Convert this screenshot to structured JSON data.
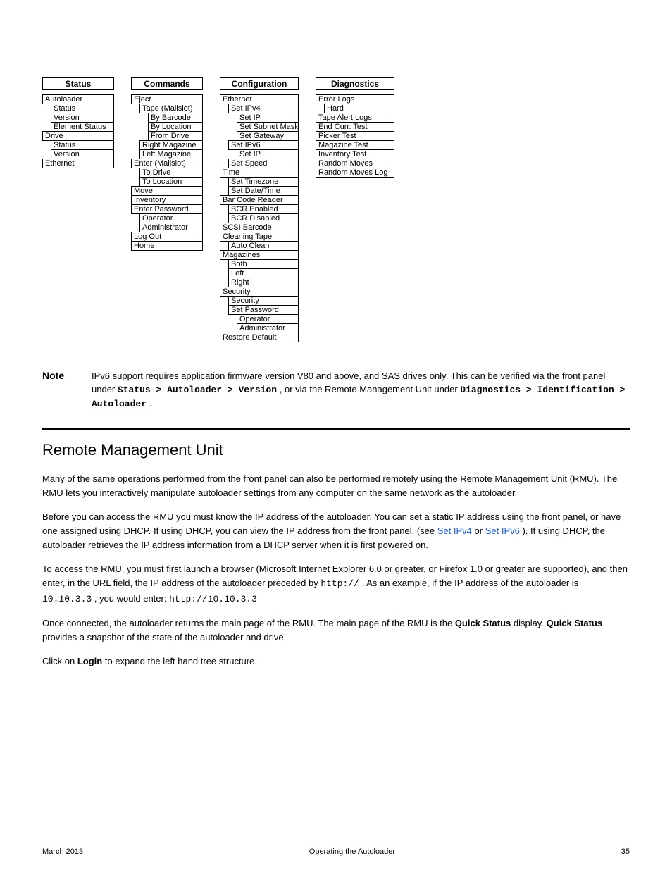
{
  "menus": {
    "status": {
      "header": "Status",
      "items": [
        {
          "lvl": 0,
          "text": "Autoloader"
        },
        {
          "lvl": 1,
          "text": "Status"
        },
        {
          "lvl": 1,
          "text": "Version"
        },
        {
          "lvl": 1,
          "text": "Element Status"
        },
        {
          "lvl": 0,
          "text": "Drive"
        },
        {
          "lvl": 1,
          "text": "Status"
        },
        {
          "lvl": 1,
          "text": "Version"
        },
        {
          "lvl": 0,
          "text": "Ethernet"
        }
      ]
    },
    "commands": {
      "header": "Commands",
      "items": [
        {
          "lvl": 0,
          "text": "Eject"
        },
        {
          "lvl": 1,
          "text": "Tape (Mailslot)"
        },
        {
          "lvl": 2,
          "text": "By Barcode"
        },
        {
          "lvl": 2,
          "text": "By Location"
        },
        {
          "lvl": 2,
          "text": "From Drive"
        },
        {
          "lvl": 1,
          "text": "Right Magazine"
        },
        {
          "lvl": 1,
          "text": "Left Magazine"
        },
        {
          "lvl": 0,
          "text": "Enter (Mailslot)"
        },
        {
          "lvl": 1,
          "text": "To Drive"
        },
        {
          "lvl": 1,
          "text": "To Location"
        },
        {
          "lvl": 0,
          "text": "Move"
        },
        {
          "lvl": 0,
          "text": "Inventory"
        },
        {
          "lvl": 0,
          "text": "Enter Password"
        },
        {
          "lvl": 1,
          "text": "Operator"
        },
        {
          "lvl": 1,
          "text": "Administrator"
        },
        {
          "lvl": 0,
          "text": "Log Out"
        },
        {
          "lvl": 0,
          "text": "Home"
        }
      ]
    },
    "configuration": {
      "header": "Configuration",
      "items": [
        {
          "lvl": 0,
          "text": "Ethernet"
        },
        {
          "lvl": 1,
          "text": "Set IPv4"
        },
        {
          "lvl": 2,
          "text": "Set IP"
        },
        {
          "lvl": 2,
          "text": "Set Subnet Mask"
        },
        {
          "lvl": 2,
          "text": "Set Gateway"
        },
        {
          "lvl": 1,
          "text": "Set IPv6"
        },
        {
          "lvl": 2,
          "text": "Set IP"
        },
        {
          "lvl": 1,
          "text": "Set Speed"
        },
        {
          "lvl": 0,
          "text": "Time"
        },
        {
          "lvl": 1,
          "text": "Set Timezone"
        },
        {
          "lvl": 1,
          "text": "Set Date/Time"
        },
        {
          "lvl": 0,
          "text": "Bar Code Reader"
        },
        {
          "lvl": 1,
          "text": "BCR Enabled"
        },
        {
          "lvl": 1,
          "text": "BCR Disabled"
        },
        {
          "lvl": 0,
          "text": "SCSI Barcode"
        },
        {
          "lvl": 0,
          "text": "Cleaning Tape"
        },
        {
          "lvl": 1,
          "text": "Auto Clean"
        },
        {
          "lvl": 0,
          "text": "Magazines"
        },
        {
          "lvl": 1,
          "text": "Both"
        },
        {
          "lvl": 1,
          "text": "Left"
        },
        {
          "lvl": 1,
          "text": "Right"
        },
        {
          "lvl": 0,
          "text": "Security"
        },
        {
          "lvl": 1,
          "text": "Security"
        },
        {
          "lvl": 1,
          "text": "Set Password"
        },
        {
          "lvl": 2,
          "text": "Operator"
        },
        {
          "lvl": 2,
          "text": "Administrator"
        },
        {
          "lvl": 0,
          "text": "Restore Default"
        }
      ]
    },
    "diagnostics": {
      "header": "Diagnostics",
      "items": [
        {
          "lvl": 0,
          "text": "Error Logs"
        },
        {
          "lvl": 1,
          "text": "Hard"
        },
        {
          "lvl": 0,
          "text": "Tape Alert Logs"
        },
        {
          "lvl": 0,
          "text": "End Curr. Test"
        },
        {
          "lvl": 0,
          "text": "Picker Test"
        },
        {
          "lvl": 0,
          "text": "Magazine Test"
        },
        {
          "lvl": 0,
          "text": "Inventory Test"
        },
        {
          "lvl": 0,
          "text": "Random Moves"
        },
        {
          "lvl": 0,
          "text": "Random Moves Log"
        }
      ]
    }
  },
  "note": {
    "label": "Note",
    "body_1": "IPv6 support requires application firmware version V80 and above, and SAS drives only. This can be verified via the front panel under ",
    "body_path1": "Status > Autoloader > Version",
    "body_2": ", or via the Remote Management Unit under ",
    "body_path2": "Diagnostics > Identification > Autoloader",
    "body_3": "."
  },
  "section": {
    "title": "Remote Management Unit",
    "p1": "Many of the same operations performed from the front panel can also be performed remotely using the Remote Management Unit (RMU). The RMU lets you interactively manipulate autoloader settings from any computer on the same network as the autoloader.",
    "p2a": "Before you can access the RMU you must know the IP address of the autoloader. You can set a static IP address using the front panel, or have one assigned using DHCP. If using DHCP, you can view the IP address from the front panel. (see ",
    "p2_link_text": "Set IPv4",
    "p2b": " or ",
    "p2_link_text2": "Set IPv6",
    "p2c": "). If using DHCP, the autoloader retrieves the IP address information from a DHCP server when it is first powered on.",
    "p3a": "To access the RMU, you must first launch a browser (Microsoft Internet Explorer 6.0 or greater, or Firefox 1.0 or greater are supported), and then enter, in the URL field, the IP address of the autoloader preceded by ",
    "p3_mono1": "http://",
    "p3b": ". As an example, if the IP address of the autoloader is ",
    "p3_mono2": "10.10.3.3",
    "p3c": ", you would enter: ",
    "p3_mono3": "http://10.10.3.3",
    "p3d": "",
    "p4a": "Once connected, the autoloader returns the main page of the RMU. The main page of the RMU is the ",
    "p4b1": "Quick Status",
    "p4c": " display. ",
    "p4b2": "Quick Status",
    "p4d": " provides a snapshot of the state of the autoloader and drive.",
    "p5a": "Click on ",
    "p5b": "Login",
    "p5c": " to expand the left hand tree structure."
  },
  "footer": {
    "date": "March 2013",
    "title": "Operating the Autoloader",
    "page": "35"
  }
}
